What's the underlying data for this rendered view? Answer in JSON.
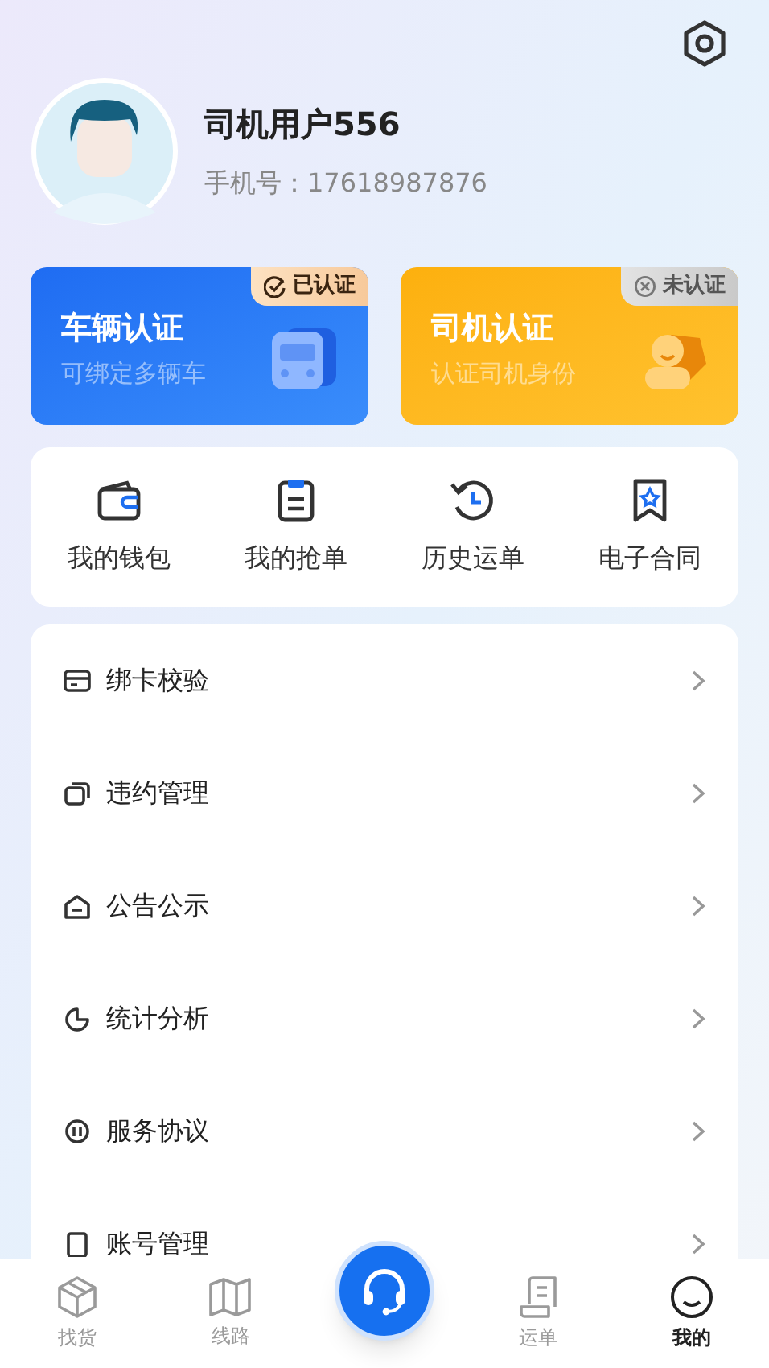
{
  "profile": {
    "name": "司机用户556",
    "phone": "手机号：17618987876"
  },
  "cert_cards": [
    {
      "kind": "vehicle",
      "title": "车辆认证",
      "subtitle": "可绑定多辆车",
      "badge": "已认证",
      "verified": true
    },
    {
      "kind": "driver",
      "title": "司机认证",
      "subtitle": "认证司机身份",
      "badge": "未认证",
      "verified": false
    }
  ],
  "shortcuts": [
    {
      "kind": "wallet",
      "label": "我的钱包"
    },
    {
      "kind": "clipboard",
      "label": "我的抢单"
    },
    {
      "kind": "history",
      "label": "历史运单"
    },
    {
      "kind": "contract",
      "label": "电子合同"
    }
  ],
  "menu": [
    {
      "kind": "card",
      "label": "绑卡校验"
    },
    {
      "kind": "copy",
      "label": "违约管理"
    },
    {
      "kind": "house",
      "label": "公告公示"
    },
    {
      "kind": "chart",
      "label": "统计分析"
    },
    {
      "kind": "agreement",
      "label": "服务协议"
    },
    {
      "kind": "account",
      "label": "账号管理"
    }
  ],
  "tab_bar": [
    {
      "kind": "box",
      "label": "找货",
      "selected": false
    },
    {
      "kind": "map",
      "label": "线路",
      "selected": false
    },
    {
      "kind": "support"
    },
    {
      "kind": "receipt",
      "label": "运单",
      "selected": false
    },
    {
      "kind": "face",
      "label": "我的",
      "selected": true
    }
  ]
}
